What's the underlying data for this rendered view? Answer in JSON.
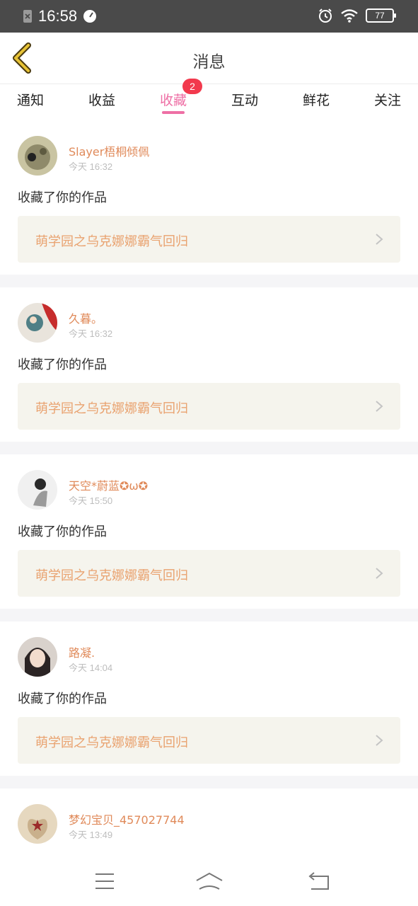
{
  "status_bar": {
    "time": "16:58",
    "battery": "77"
  },
  "header": {
    "title": "消息"
  },
  "tabs": [
    {
      "label": "通知"
    },
    {
      "label": "收益"
    },
    {
      "label": "收藏",
      "badge": "2"
    },
    {
      "label": "互动"
    },
    {
      "label": "鲜花"
    },
    {
      "label": "关注"
    }
  ],
  "items": [
    {
      "user": "Slayer梧桐倾佩",
      "time": "今天 16:32",
      "action": "收藏了你的作品",
      "work": "萌学园之乌克娜娜霸气回归"
    },
    {
      "user": "久暮。",
      "time": "今天 16:32",
      "action": "收藏了你的作品",
      "work": "萌学园之乌克娜娜霸气回归"
    },
    {
      "user": "天空*蔚蓝✪ω✪",
      "time": "今天 15:50",
      "action": "收藏了你的作品",
      "work": "萌学园之乌克娜娜霸气回归"
    },
    {
      "user": "路凝.",
      "time": "今天 14:04",
      "action": "收藏了你的作品",
      "work": "萌学园之乌克娜娜霸气回归"
    },
    {
      "user": "梦幻宝贝_457027744",
      "time": "今天 13:49"
    }
  ],
  "icons": {
    "back": "chevron-left-icon",
    "chevron": "chevron-right-icon",
    "nav": [
      "menu-icon",
      "home-icon",
      "back-return-icon"
    ]
  },
  "colors": {
    "accent": "#ee6fa5",
    "username": "#e08a5a",
    "work_title": "#e9a26f",
    "badge": "#f2394d",
    "back_icon": "#e6c236"
  }
}
